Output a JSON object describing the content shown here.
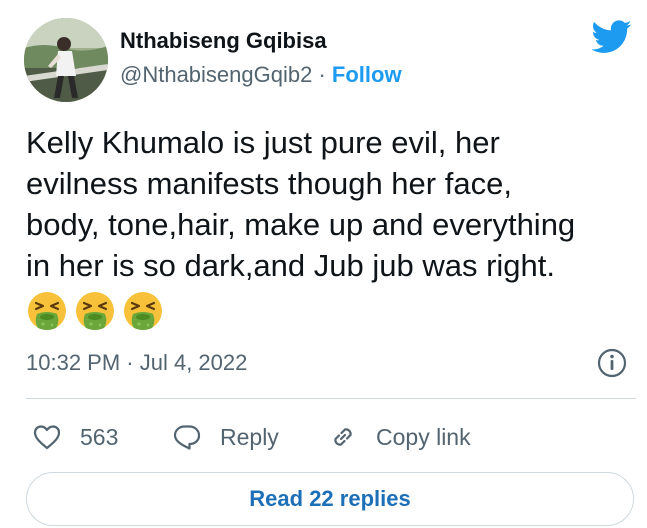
{
  "author": {
    "name": "Nthabiseng Gqibisa",
    "handle": "@NthabisengGqib2",
    "separator": "·",
    "follow_label": "Follow"
  },
  "tweet": {
    "text": "Kelly Khumalo is just pure evil, her\nevilness manifests though her face,\nbody, tone,hair, make up and everything\nin her is so dark,and Jub jub was right.",
    "emojis": [
      "face-vomiting",
      "face-vomiting",
      "face-vomiting"
    ],
    "timestamp": "10:32 PM · Jul 4, 2022"
  },
  "actions": {
    "like_count": "563",
    "reply_label": "Reply",
    "copy_link_label": "Copy link"
  },
  "replies_button": {
    "label": "Read 22 replies"
  },
  "icons": {
    "logo": "twitter-bird-icon",
    "info": "info-icon",
    "like": "heart-icon",
    "reply": "speech-bubble-icon",
    "copy": "link-icon"
  },
  "colors": {
    "accent": "#1d9bf0",
    "text_primary": "#0f1419",
    "text_secondary": "#536471",
    "border": "#cfd9de",
    "replies_text": "#1d6fb8"
  }
}
